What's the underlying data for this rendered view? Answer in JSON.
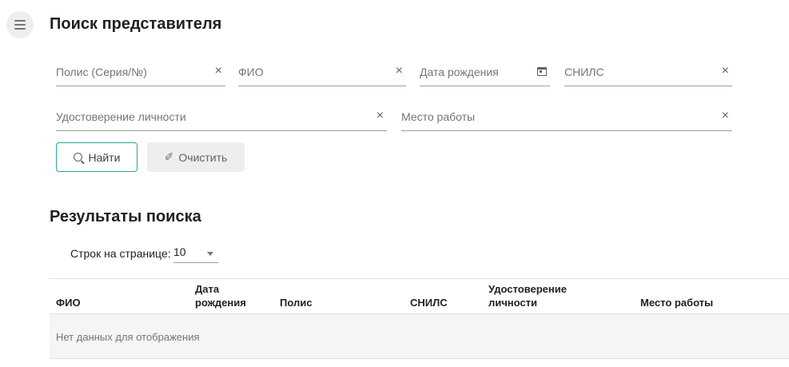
{
  "header": {
    "title": "Поиск представителя"
  },
  "search_form": {
    "policy": {
      "placeholder": "Полис (Серия/№)",
      "value": ""
    },
    "fio": {
      "placeholder": "ФИО",
      "value": ""
    },
    "birth_date": {
      "placeholder": "Дата рождения",
      "value": ""
    },
    "snils": {
      "placeholder": "СНИЛС",
      "value": ""
    },
    "identity_doc": {
      "placeholder": "Удостоверение личности",
      "value": ""
    },
    "workplace": {
      "placeholder": "Место работы",
      "value": ""
    },
    "clear_glyph": "×",
    "find_label": "Найти",
    "clear_label": "Очистить",
    "clear_button_glyph": "✐"
  },
  "results": {
    "title": "Результаты поиска",
    "rows_per_page_label": "Строк на странице:",
    "rows_per_page_value": "10",
    "columns": {
      "fio": "ФИО",
      "birth_date_line1": "Дата",
      "birth_date_line2": "рождения",
      "policy": "Полис",
      "snils": "СНИЛС",
      "identity_line1": "Удостоверение",
      "identity_line2": "личности",
      "workplace": "Место работы"
    },
    "empty_text": "Нет данных для отображения"
  },
  "colors": {
    "accent": "#26a69a",
    "text": "#212121",
    "muted": "#757575"
  }
}
